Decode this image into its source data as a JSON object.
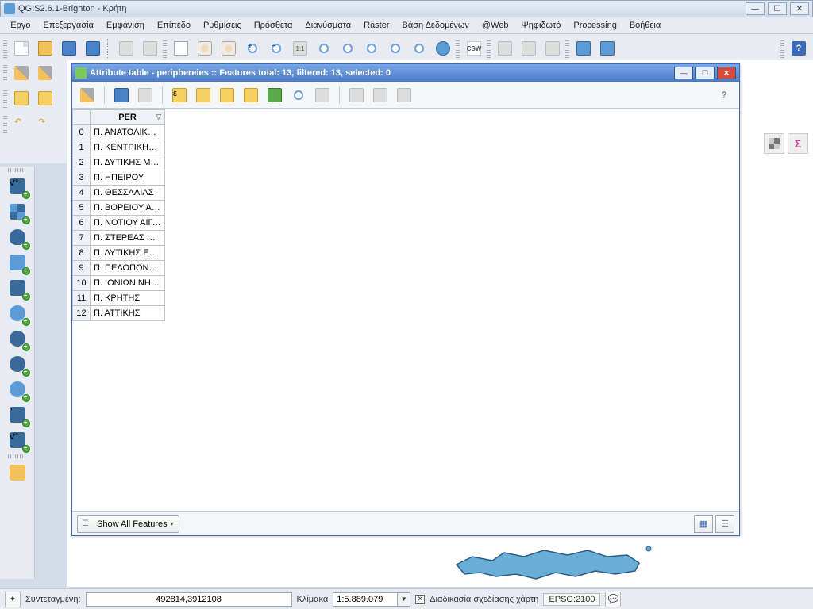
{
  "title": "QGIS2.6.1-Brighton - Κρήτη",
  "menu": [
    "Έργο",
    "Επεξεργασία",
    "Εμφάνιση",
    "Επίπεδο",
    "Ρυθμίσεις",
    "Πρόσθετα",
    "Διανύσματα",
    "Raster",
    "Βάση Δεδομένων",
    "@Web",
    "Ψηφιδωτό",
    "Processing",
    "Βοήθεια"
  ],
  "attr": {
    "title": "Attribute table - periphereies :: Features total: 13, filtered: 13, selected: 0",
    "column": "PER",
    "rows": [
      "Π. ΑΝΑΤΟΛΙΚΗΣ ...",
      "Π. ΚΕΝΤΡΙΚΗΣ Μ...",
      "Π. ΔΥΤΙΚΗΣ ΜΑΚ...",
      "Π. ΗΠΕΙΡΟΥ",
      "Π. ΘΕΣΣΑΛΙΑΣ",
      "Π. ΒΟΡΕΙΟΥ ΑΙΓ...",
      "Π. ΝΟΤΙΟΥ ΑΙΓΑ...",
      "Π. ΣΤΕΡΕΑΣ ΕΛΛ...",
      "Π. ΔΥΤΙΚΗΣ ΕΛΛ...",
      "Π. ΠΕΛΟΠΟΝΝΗ...",
      "Π. ΙΟΝΙΩΝ ΝΗΣΩΝ",
      "Π. ΚΡΗΤΗΣ",
      "Π. ΑΤΤΙΚΗΣ"
    ],
    "show_all": "Show All Features"
  },
  "status": {
    "coord_label": "Συντεταγμένη:",
    "coord_value": "492814,3912108",
    "scale_label": "Κλίμακα",
    "scale_value": "1:5.889.079",
    "render_label": "Διαδικασία σχεδίασης χάρτη",
    "epsg": "EPSG:2100"
  }
}
